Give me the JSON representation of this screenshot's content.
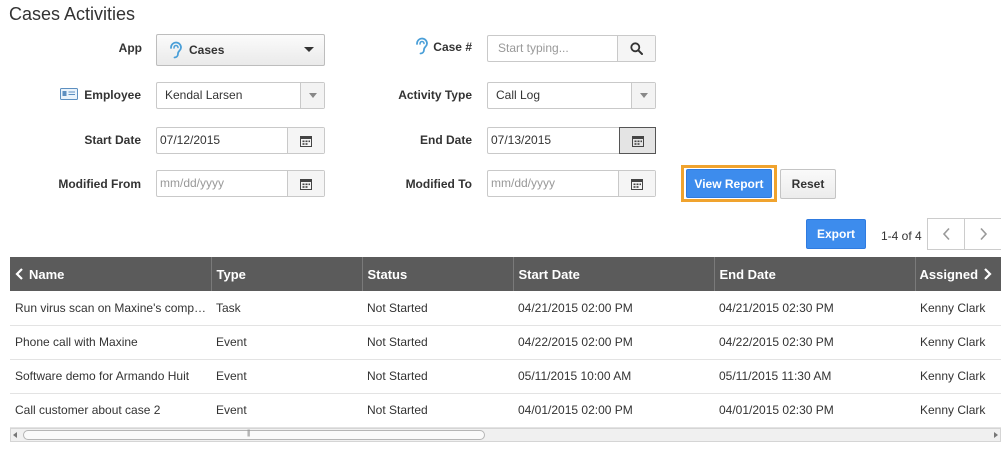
{
  "page": {
    "title": "Cases Activities"
  },
  "form": {
    "app": {
      "label": "App",
      "value": "Cases",
      "icon": "ear-icon"
    },
    "case_number": {
      "label": "Case #",
      "placeholder": "Start typing...",
      "icon": "ear-icon"
    },
    "employee": {
      "label": "Employee",
      "value": "Kendal Larsen",
      "icon": "id-card-icon"
    },
    "activity_type": {
      "label": "Activity Type",
      "value": "Call Log"
    },
    "start_date": {
      "label": "Start Date",
      "value": "07/12/2015"
    },
    "end_date": {
      "label": "End Date",
      "value": "07/13/2015"
    },
    "modified_from": {
      "label": "Modified From",
      "placeholder": "mm/dd/yyyy"
    },
    "modified_to": {
      "label": "Modified To",
      "placeholder": "mm/dd/yyyy"
    }
  },
  "buttons": {
    "view_report": "View Report",
    "reset": "Reset",
    "export": "Export"
  },
  "pager": {
    "text": "1-4 of 4"
  },
  "colors": {
    "primary": "#3d8ced",
    "focus": "#f0a32e",
    "header_bg": "#5b5b5b",
    "accent_icon": "#4a9fd8"
  },
  "table": {
    "columns": [
      "Name",
      "Type",
      "Status",
      "Start Date",
      "End Date",
      "Assigned"
    ],
    "rows": [
      [
        "Run virus scan on Maxine's computer",
        "Task",
        "Not Started",
        "04/21/2015 02:00 PM",
        "04/21/2015 02:30 PM",
        "Kenny Clark"
      ],
      [
        "Phone call with Maxine",
        "Event",
        "Not Started",
        "04/22/2015 02:00 PM",
        "04/22/2015 02:30 PM",
        "Kenny Clark"
      ],
      [
        "Software demo for Armando Huit",
        "Event",
        "Not Started",
        "05/11/2015 10:00 AM",
        "05/11/2015 11:30 AM",
        "Kenny Clark"
      ],
      [
        "Call customer about case 2",
        "Event",
        "Not Started",
        "04/01/2015 02:00 PM",
        "04/01/2015 02:30 PM",
        "Kenny Clark"
      ]
    ]
  }
}
